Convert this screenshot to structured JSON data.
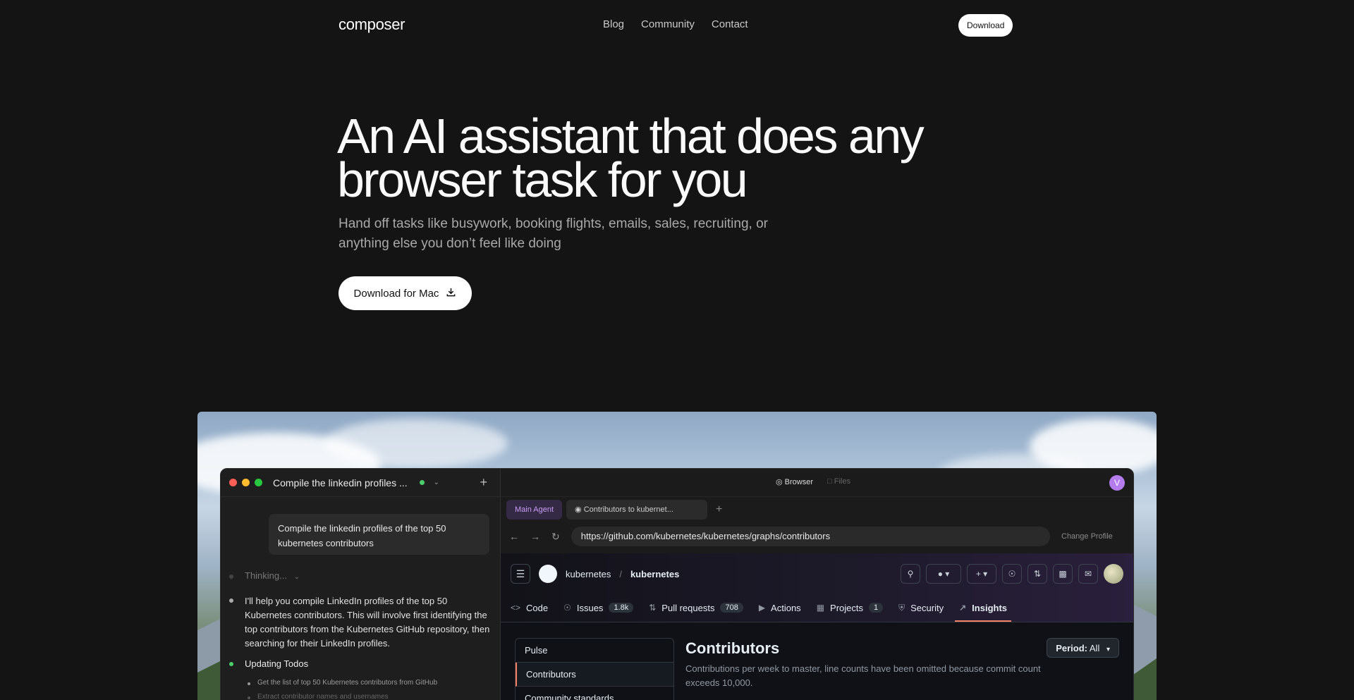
{
  "nav": {
    "logo": "composer",
    "links": [
      "Blog",
      "Community",
      "Contact"
    ],
    "download_label": "Download"
  },
  "hero": {
    "title_line1": "An AI assistant that does any",
    "title_line2": "browser task for you",
    "subtitle_line1": "Hand off tasks like busywork, booking flights, emails, sales, recruiting, or",
    "subtitle_line2": "anything else you don’t feel like doing",
    "cta_label": "Download for Mac"
  },
  "app": {
    "session_title": "Compile the linkedin profiles ...",
    "prompt": "Compile the linkedin profiles of the top 50 kubernetes contributors",
    "thinking": "Thinking...",
    "message": "I'll help you compile LinkedIn profiles of the top 50 Kubernetes contributors. This will involve first identifying the top contributors from the Kubernetes GitHub repository, then searching for their LinkedIn profiles.",
    "todos_label": "Updating Todos",
    "todo_items": [
      "Get the list of top 50 Kubernetes contributors from GitHub",
      "Extract contributor names and usernames"
    ],
    "browser_label": "Browser",
    "files_label": "Files",
    "user_initial": "V",
    "tabs": [
      "Main Agent",
      "Contributors to kubernet..."
    ],
    "url": "https://github.com/kubernetes/kubernetes/graphs/contributors",
    "change_profile": "Change Profile"
  },
  "github": {
    "owner": "kubernetes",
    "separator": "/",
    "repo": "kubernetes",
    "tabs": [
      {
        "label": "Code",
        "icon": "code-icon"
      },
      {
        "label": "Issues",
        "count": "1.8k",
        "icon": "issue-icon"
      },
      {
        "label": "Pull requests",
        "count": "708",
        "icon": "pull-request-icon"
      },
      {
        "label": "Actions",
        "icon": "play-icon"
      },
      {
        "label": "Projects",
        "count": "1",
        "icon": "table-icon"
      },
      {
        "label": "Security",
        "icon": "shield-icon"
      },
      {
        "label": "Insights",
        "icon": "graph-icon"
      }
    ],
    "sidebar": [
      "Pulse",
      "Contributors",
      "Community standards"
    ],
    "title": "Contributors",
    "description": "Contributions per week to master, line counts have been omitted because commit count exceeds 10,000.",
    "period_key": "Period:",
    "period_value": "All"
  },
  "colors": {
    "accent_tab": "#f78166",
    "agent_purple": "#b57cf0",
    "status_green": "#4ccf6a"
  }
}
